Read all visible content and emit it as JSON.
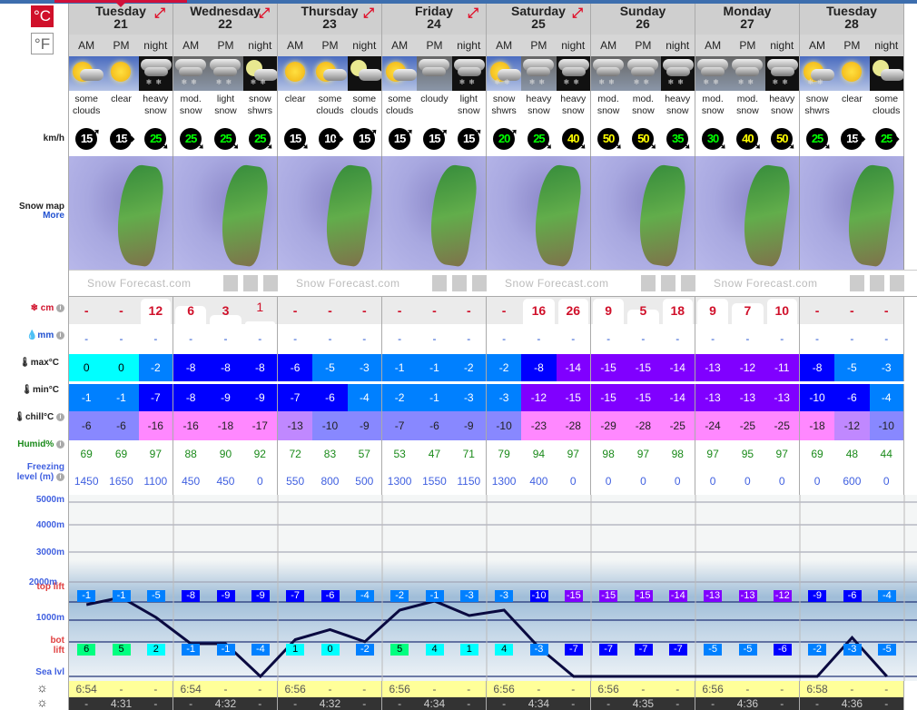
{
  "units": {
    "celsius": "°C",
    "fahrenheit": "°F"
  },
  "labels": {
    "wind": "km/h",
    "snowmap": "Snow map",
    "more": "More",
    "snow": "cm",
    "rain": "mm",
    "max": "max°C",
    "min": "min°C",
    "chill": "chill°C",
    "humid": "Humid%",
    "freezing": "Freezing level (m)",
    "h5000": "5000m",
    "h4000": "4000m",
    "h3000": "3000m",
    "h2000": "2000m",
    "top_lift": "top lift",
    "h1000": "1000m",
    "bot_lift": "bot lift",
    "sea": "Sea lvl"
  },
  "brand": "Snow Forecast.com",
  "days": [
    {
      "name": "Tuesday",
      "date": "21",
      "expand": true
    },
    {
      "name": "Wednesday",
      "date": "22",
      "expand": true
    },
    {
      "name": "Thursday",
      "date": "23",
      "expand": true
    },
    {
      "name": "Friday",
      "date": "24",
      "expand": true
    },
    {
      "name": "Saturday",
      "date": "25",
      "expand": true
    },
    {
      "name": "Sunday",
      "date": "26",
      "expand": false
    },
    {
      "name": "Monday",
      "date": "27",
      "expand": false
    },
    {
      "name": "Tuesday",
      "date": "28",
      "expand": false
    }
  ],
  "periods": [
    "AM",
    "PM",
    "night"
  ],
  "icons": [
    "day-sun-cloud",
    "day-sun",
    "night-cloud-snow",
    "overcast-cloud-snow",
    "overcast-cloud-snow",
    "night-moon-cloud-snow",
    "day-sun",
    "day-sun-cloud",
    "night-moon-cloud",
    "day-sun-cloud",
    "overcast-cloud",
    "night-cloud-snow",
    "day-sun-cloud-snow",
    "overcast-cloud-snow",
    "night-cloud-snow",
    "overcast-cloud-snow",
    "overcast-cloud-snow",
    "night-cloud-snow",
    "overcast-cloud-snow",
    "overcast-cloud-snow",
    "night-cloud-snow",
    "day-sun-cloud-snow",
    "day-sun",
    "night-moon-cloud"
  ],
  "weather": [
    "some clouds",
    "clear",
    "heavy snow",
    "mod. snow",
    "light snow",
    "snow shwrs",
    "clear",
    "some clouds",
    "some clouds",
    "some clouds",
    "cloudy",
    "light snow",
    "snow shwrs",
    "heavy snow",
    "heavy snow",
    "mod. snow",
    "mod. snow",
    "heavy snow",
    "mod. snow",
    "mod. snow",
    "heavy snow",
    "snow shwrs",
    "clear",
    "some clouds"
  ],
  "wind": [
    {
      "v": "15",
      "d": "ne",
      "c": "#ffffff"
    },
    {
      "v": "15",
      "d": "e",
      "c": "#ffffff"
    },
    {
      "v": "25",
      "d": "se",
      "c": "#00ff00"
    },
    {
      "v": "25",
      "d": "se",
      "c": "#00ff00"
    },
    {
      "v": "25",
      "d": "se",
      "c": "#00ff00"
    },
    {
      "v": "25",
      "d": "se",
      "c": "#00ff00"
    },
    {
      "v": "15",
      "d": "se",
      "c": "#ffffff"
    },
    {
      "v": "10",
      "d": "e",
      "c": "#ffffff"
    },
    {
      "v": "15",
      "d": "ne",
      "c": "#ffffff"
    },
    {
      "v": "15",
      "d": "ne",
      "c": "#ffffff"
    },
    {
      "v": "15",
      "d": "ne",
      "c": "#ffffff"
    },
    {
      "v": "15",
      "d": "ne",
      "c": "#ffffff"
    },
    {
      "v": "20",
      "d": "ne",
      "c": "#00ff00"
    },
    {
      "v": "25",
      "d": "se",
      "c": "#00ff00"
    },
    {
      "v": "40",
      "d": "se",
      "c": "#ffff00"
    },
    {
      "v": "50",
      "d": "se",
      "c": "#ffff00"
    },
    {
      "v": "50",
      "d": "se",
      "c": "#ffff00"
    },
    {
      "v": "35",
      "d": "se",
      "c": "#00ff00"
    },
    {
      "v": "30",
      "d": "se",
      "c": "#00ff00"
    },
    {
      "v": "40",
      "d": "se",
      "c": "#ffff00"
    },
    {
      "v": "50",
      "d": "se",
      "c": "#ffff00"
    },
    {
      "v": "25",
      "d": "se",
      "c": "#00ff00"
    },
    {
      "v": "15",
      "d": "e",
      "c": "#ffffff"
    },
    {
      "v": "25",
      "d": "e",
      "c": "#00ff00"
    }
  ],
  "snow_cm": [
    "-",
    "-",
    "12",
    "6",
    "3",
    "1",
    "-",
    "-",
    "-",
    "-",
    "-",
    "-",
    "-",
    "16",
    "26",
    "9",
    "5",
    "18",
    "9",
    "7",
    "10",
    "-",
    "-",
    "-"
  ],
  "rain_mm": [
    "-",
    "-",
    "-",
    "-",
    "-",
    "-",
    "-",
    "-",
    "-",
    "-",
    "-",
    "-",
    "-",
    "-",
    "-",
    "-",
    "-",
    "-",
    "-",
    "-",
    "-",
    "-",
    "-",
    "-"
  ],
  "max_c": [
    "0",
    "0",
    "-2",
    "-8",
    "-8",
    "-8",
    "-6",
    "-5",
    "-3",
    "-1",
    "-1",
    "-2",
    "-2",
    "-8",
    "-14",
    "-15",
    "-15",
    "-14",
    "-13",
    "-12",
    "-11",
    "-8",
    "-5",
    "-3"
  ],
  "min_c": [
    "-1",
    "-1",
    "-7",
    "-8",
    "-9",
    "-9",
    "-7",
    "-6",
    "-4",
    "-2",
    "-1",
    "-3",
    "-3",
    "-12",
    "-15",
    "-15",
    "-15",
    "-14",
    "-13",
    "-13",
    "-13",
    "-10",
    "-6",
    "-4"
  ],
  "chill_c": [
    "-6",
    "-6",
    "-16",
    "-16",
    "-18",
    "-17",
    "-13",
    "-10",
    "-9",
    "-7",
    "-6",
    "-9",
    "-10",
    "-23",
    "-28",
    "-29",
    "-28",
    "-25",
    "-24",
    "-25",
    "-25",
    "-18",
    "-12",
    "-10"
  ],
  "humid": [
    "69",
    "69",
    "97",
    "88",
    "90",
    "92",
    "72",
    "83",
    "57",
    "53",
    "47",
    "71",
    "79",
    "94",
    "97",
    "98",
    "97",
    "98",
    "97",
    "95",
    "97",
    "69",
    "48",
    "44"
  ],
  "freezing": [
    "1450",
    "1650",
    "1100",
    "450",
    "450",
    "0",
    "550",
    "800",
    "500",
    "1300",
    "1550",
    "1150",
    "1300",
    "400",
    "0",
    "0",
    "0",
    "0",
    "0",
    "0",
    "0",
    "0",
    "600",
    "0"
  ],
  "top_lift": [
    "-1",
    "-1",
    "-5",
    "-8",
    "-9",
    "-9",
    "-7",
    "-6",
    "-4",
    "-2",
    "-1",
    "-3",
    "-3",
    "-10",
    "-15",
    "-15",
    "-15",
    "-14",
    "-13",
    "-13",
    "-12",
    "-9",
    "-6",
    "-4"
  ],
  "bot_lift": [
    "6",
    "5",
    "2",
    "-1",
    "-1",
    "-4",
    "1",
    "0",
    "-2",
    "5",
    "4",
    "1",
    "4",
    "-3",
    "-7",
    "-7",
    "-7",
    "-7",
    "-5",
    "-5",
    "-6",
    "-2",
    "-3",
    "-5"
  ],
  "sunrise": [
    "6:54",
    "-",
    "-",
    "6:54",
    "-",
    "-",
    "6:56",
    "-",
    "-",
    "6:56",
    "-",
    "-",
    "6:56",
    "-",
    "-",
    "6:56",
    "-",
    "-",
    "6:56",
    "-",
    "-",
    "6:58",
    "-",
    "-"
  ],
  "sunset": [
    "-",
    "4:31",
    "-",
    "-",
    "4:32",
    "-",
    "-",
    "4:32",
    "-",
    "-",
    "4:34",
    "-",
    "-",
    "4:34",
    "-",
    "-",
    "4:35",
    "-",
    "-",
    "4:36",
    "-",
    "-",
    "4:36",
    "-"
  ],
  "colors": {
    "accent": "#d0102a",
    "snow_text": "#d0102a",
    "rain_text": "#2050d0",
    "humid_text": "#1a8a1a",
    "freezing_text": "#4060e0",
    "temp_warm": "#00ffff",
    "temp_cold1": "#0080ff",
    "temp_cold2": "#0000ff",
    "temp_cold3": "#8000ff"
  }
}
